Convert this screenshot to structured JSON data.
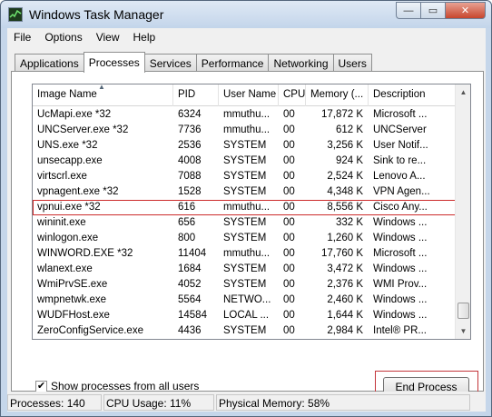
{
  "window": {
    "title": "Windows Task Manager"
  },
  "titlebar_buttons": {
    "minimize": "—",
    "maximize": "▭",
    "close": "✕"
  },
  "menu": [
    "File",
    "Options",
    "View",
    "Help"
  ],
  "tabs": [
    "Applications",
    "Processes",
    "Services",
    "Performance",
    "Networking",
    "Users"
  ],
  "active_tab": "Processes",
  "columns": [
    "Image Name",
    "PID",
    "User Name",
    "CPU",
    "Memory (...",
    "Description"
  ],
  "sorted_column": "Image Name",
  "rows": [
    {
      "name": "UcMapi.exe *32",
      "pid": "6324",
      "user": "mmuthu...",
      "cpu": "00",
      "mem": "17,872 K",
      "desc": "Microsoft ..."
    },
    {
      "name": "UNCServer.exe *32",
      "pid": "7736",
      "user": "mmuthu...",
      "cpu": "00",
      "mem": "612 K",
      "desc": "UNCServer"
    },
    {
      "name": "UNS.exe *32",
      "pid": "2536",
      "user": "SYSTEM",
      "cpu": "00",
      "mem": "3,256 K",
      "desc": "User Notif..."
    },
    {
      "name": "unsecapp.exe",
      "pid": "4008",
      "user": "SYSTEM",
      "cpu": "00",
      "mem": "924 K",
      "desc": "Sink to re..."
    },
    {
      "name": "virtscrl.exe",
      "pid": "7088",
      "user": "SYSTEM",
      "cpu": "00",
      "mem": "2,524 K",
      "desc": "Lenovo A..."
    },
    {
      "name": "vpnagent.exe *32",
      "pid": "1528",
      "user": "SYSTEM",
      "cpu": "00",
      "mem": "4,348 K",
      "desc": "VPN Agen..."
    },
    {
      "name": "vpnui.exe *32",
      "pid": "616",
      "user": "mmuthu...",
      "cpu": "00",
      "mem": "8,556 K",
      "desc": "Cisco Any..."
    },
    {
      "name": "wininit.exe",
      "pid": "656",
      "user": "SYSTEM",
      "cpu": "00",
      "mem": "332 K",
      "desc": "Windows ..."
    },
    {
      "name": "winlogon.exe",
      "pid": "800",
      "user": "SYSTEM",
      "cpu": "00",
      "mem": "1,260 K",
      "desc": "Windows ..."
    },
    {
      "name": "WINWORD.EXE *32",
      "pid": "11404",
      "user": "mmuthu...",
      "cpu": "00",
      "mem": "17,760 K",
      "desc": "Microsoft ..."
    },
    {
      "name": "wlanext.exe",
      "pid": "1684",
      "user": "SYSTEM",
      "cpu": "00",
      "mem": "3,472 K",
      "desc": "Windows ..."
    },
    {
      "name": "WmiPrvSE.exe",
      "pid": "4052",
      "user": "SYSTEM",
      "cpu": "00",
      "mem": "2,376 K",
      "desc": "WMI Prov..."
    },
    {
      "name": "wmpnetwk.exe",
      "pid": "5564",
      "user": "NETWO...",
      "cpu": "00",
      "mem": "2,460 K",
      "desc": "Windows ..."
    },
    {
      "name": "WUDFHost.exe",
      "pid": "14584",
      "user": "LOCAL ...",
      "cpu": "00",
      "mem": "1,644 K",
      "desc": "Windows ..."
    },
    {
      "name": "ZeroConfigService.exe",
      "pid": "4436",
      "user": "SYSTEM",
      "cpu": "00",
      "mem": "2,984 K",
      "desc": "Intel® PR..."
    }
  ],
  "selected_row": "vpnui.exe *32",
  "show_all_processes": {
    "label": "Show processes from all users",
    "checked": true,
    "mark": "✔"
  },
  "end_process_label": "End Process",
  "status": {
    "processes": "Processes: 140",
    "cpu": "CPU Usage: 11%",
    "memory": "Physical Memory: 58%"
  }
}
